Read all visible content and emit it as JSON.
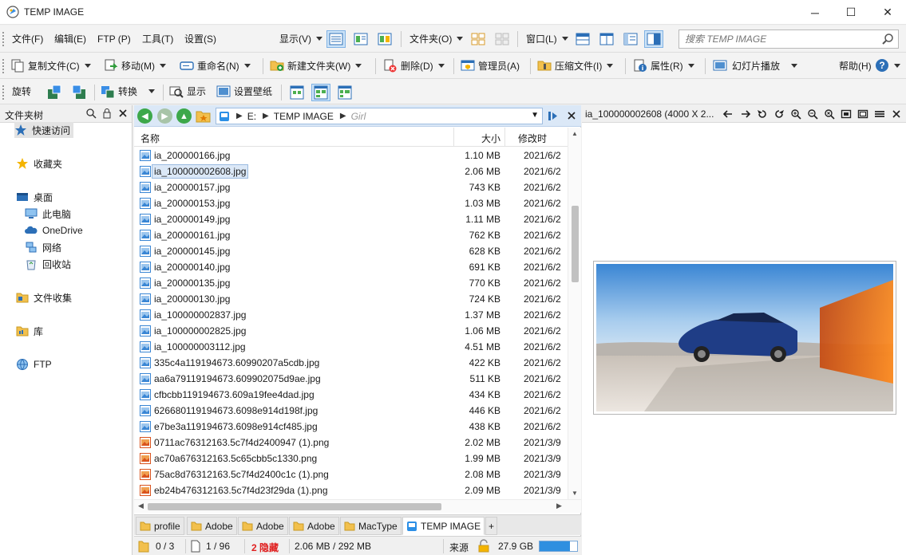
{
  "window": {
    "title": "TEMP IMAGE",
    "minimize": "─",
    "maximize": "☐",
    "close": "✕"
  },
  "menubar": {
    "items": [
      "文件(F)",
      "编辑(E)",
      "FTP (P)",
      "工具(T)",
      "设置(S)"
    ],
    "display_label": "显示(V)",
    "folder_label": "文件夹(O)",
    "window_label": "窗口(L)"
  },
  "search": {
    "placeholder": "搜索 TEMP IMAGE"
  },
  "toolbar2": {
    "copy": "复制文件(C)",
    "move": "移动(M)",
    "rename": "重命名(N)",
    "new_folder": "新建文件夹(W)",
    "delete": "删除(D)",
    "admin": "管理员(A)",
    "compress": "压缩文件(I)",
    "properties": "属性(R)",
    "slideshow": "幻灯片播放",
    "help": "帮助(H)"
  },
  "toolbar3": {
    "rotate": "旋转",
    "convert": "转换",
    "show": "显示",
    "wallpaper": "设置壁纸"
  },
  "tree": {
    "title": "文件夹树",
    "quick_access": "快速访问",
    "favorites": "收藏夹",
    "desktop": "桌面",
    "this_pc": "此电脑",
    "onedrive": "OneDrive",
    "network": "网络",
    "recycle": "回收站",
    "collection": "文件收集",
    "library": "库",
    "ftp": "FTP"
  },
  "address": {
    "drive": "E:",
    "folder": "TEMP IMAGE",
    "hint": "Girl"
  },
  "columns": {
    "name": "名称",
    "size": "大小",
    "modified": "修改时"
  },
  "files": [
    {
      "name": "ia_200000166.jpg",
      "size": "1.10 MB",
      "date": "2021/6/2",
      "type": "jpg"
    },
    {
      "name": "ia_100000002608.jpg",
      "size": "2.06 MB",
      "date": "2021/6/2",
      "type": "jpg",
      "selected": true
    },
    {
      "name": "ia_200000157.jpg",
      "size": "743 KB",
      "date": "2021/6/2",
      "type": "jpg"
    },
    {
      "name": "ia_200000153.jpg",
      "size": "1.03 MB",
      "date": "2021/6/2",
      "type": "jpg"
    },
    {
      "name": "ia_200000149.jpg",
      "size": "1.11 MB",
      "date": "2021/6/2",
      "type": "jpg"
    },
    {
      "name": "ia_200000161.jpg",
      "size": "762 KB",
      "date": "2021/6/2",
      "type": "jpg"
    },
    {
      "name": "ia_200000145.jpg",
      "size": "628 KB",
      "date": "2021/6/2",
      "type": "jpg"
    },
    {
      "name": "ia_200000140.jpg",
      "size": "691 KB",
      "date": "2021/6/2",
      "type": "jpg"
    },
    {
      "name": "ia_200000135.jpg",
      "size": "770 KB",
      "date": "2021/6/2",
      "type": "jpg"
    },
    {
      "name": "ia_200000130.jpg",
      "size": "724 KB",
      "date": "2021/6/2",
      "type": "jpg"
    },
    {
      "name": "ia_100000002837.jpg",
      "size": "1.37 MB",
      "date": "2021/6/2",
      "type": "jpg"
    },
    {
      "name": "ia_100000002825.jpg",
      "size": "1.06 MB",
      "date": "2021/6/2",
      "type": "jpg"
    },
    {
      "name": "ia_100000003112.jpg",
      "size": "4.51 MB",
      "date": "2021/6/2",
      "type": "jpg"
    },
    {
      "name": "335c4a119194673.60990207a5cdb.jpg",
      "size": "422 KB",
      "date": "2021/6/2",
      "type": "jpg"
    },
    {
      "name": "aa6a79119194673.609902075d9ae.jpg",
      "size": "511 KB",
      "date": "2021/6/2",
      "type": "jpg"
    },
    {
      "name": "cfbcbb119194673.609a19fee4dad.jpg",
      "size": "434 KB",
      "date": "2021/6/2",
      "type": "jpg"
    },
    {
      "name": "626680119194673.6098e914d198f.jpg",
      "size": "446 KB",
      "date": "2021/6/2",
      "type": "jpg"
    },
    {
      "name": "e7be3a119194673.6098e914cf485.jpg",
      "size": "438 KB",
      "date": "2021/6/2",
      "type": "jpg"
    },
    {
      "name": "0711ac76312163.5c7f4d2400947 (1).png",
      "size": "2.02 MB",
      "date": "2021/3/9",
      "type": "png"
    },
    {
      "name": "ac70a676312163.5c65cbb5c1330.png",
      "size": "1.99 MB",
      "date": "2021/3/9",
      "type": "png"
    },
    {
      "name": "75ac8d76312163.5c7f4d2400c1c (1).png",
      "size": "2.08 MB",
      "date": "2021/3/9",
      "type": "png"
    },
    {
      "name": "eb24b476312163.5c7f4d23f29da (1).png",
      "size": "2.09 MB",
      "date": "2021/3/9",
      "type": "png"
    }
  ],
  "tabs": [
    "profile",
    "Adobe",
    "Adobe",
    "Adobe",
    "MacType",
    "TEMP IMAGE"
  ],
  "tab_add": "+",
  "status": {
    "selected": "0 / 3",
    "files": "1 / 96",
    "hidden": "2 隐藏",
    "size": "2.06 MB / 292 MB",
    "source": "来源",
    "disk": "27.9 GB",
    "disk_used_fraction": 0.8
  },
  "preview": {
    "title": "ia_100000002608 (4000 X 2..."
  },
  "colors": {
    "accent": "#cde3f7",
    "address_bar": "#dbe8f7",
    "hidden_red": "#e02020",
    "disk_bar": "#2f8fe0"
  }
}
